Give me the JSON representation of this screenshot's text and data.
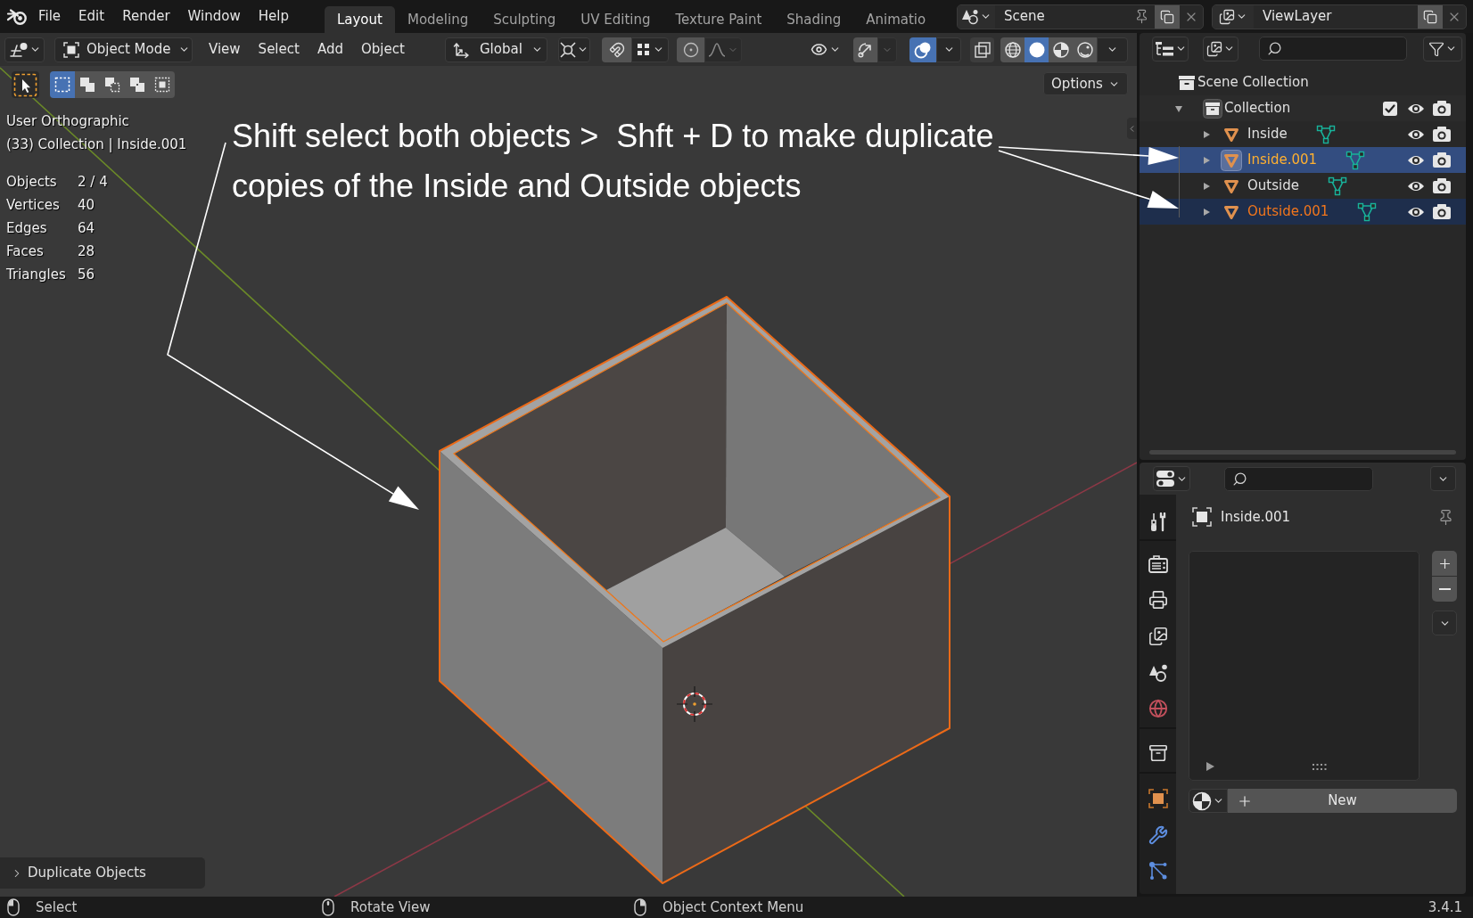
{
  "top_bar": {
    "menus": [
      "File",
      "Edit",
      "Render",
      "Window",
      "Help"
    ],
    "workspaces": [
      {
        "label": "Layout",
        "selected": true
      },
      {
        "label": "Modeling",
        "selected": false
      },
      {
        "label": "Sculpting",
        "selected": false
      },
      {
        "label": "UV Editing",
        "selected": false
      },
      {
        "label": "Texture Paint",
        "selected": false
      },
      {
        "label": "Shading",
        "selected": false
      },
      {
        "label": "Animatio",
        "selected": false
      }
    ],
    "scene": "Scene",
    "view_layer": "ViewLayer"
  },
  "viewport": {
    "header": {
      "mode": "Object Mode",
      "menus": [
        "View",
        "Select",
        "Add",
        "Object"
      ],
      "orientation": "Global",
      "overlays_on": true,
      "shading_modes": [
        {
          "kind": "wireframe",
          "selected": false
        },
        {
          "kind": "solid",
          "selected": true
        },
        {
          "kind": "material",
          "selected": false
        },
        {
          "kind": "rendered",
          "selected": false
        }
      ]
    },
    "selection_modes": [
      {
        "kind": "set",
        "selected": true
      },
      {
        "kind": "extend",
        "selected": false
      },
      {
        "kind": "subtract",
        "selected": false
      },
      {
        "kind": "difference",
        "selected": false
      },
      {
        "kind": "intersect",
        "selected": false
      }
    ],
    "options": "Options",
    "overlay_text": {
      "view": "User Orthographic",
      "context": "(33) Collection | Inside.001",
      "stats": [
        {
          "label": "Objects",
          "value": "2 / 4"
        },
        {
          "label": "Vertices",
          "value": "40"
        },
        {
          "label": "Edges",
          "value": "64"
        },
        {
          "label": "Faces",
          "value": "28"
        },
        {
          "label": "Triangles",
          "value": "56"
        }
      ]
    },
    "annotation": [
      "Shift select both objects >  Shft + D to make duplicate",
      "copies of the Inside and Outside objects"
    ],
    "last_operation": "Duplicate Objects"
  },
  "outliner": {
    "root": "Scene Collection",
    "collections": [
      {
        "label": "Collection",
        "expanded": true,
        "checked": true,
        "children": [
          {
            "label": "Inside",
            "expanded": false,
            "selected": false,
            "active": false
          },
          {
            "label": "Inside.001",
            "expanded": false,
            "selected": true,
            "active": true
          },
          {
            "label": "Outside",
            "expanded": false,
            "selected": false,
            "active": false
          },
          {
            "label": "Outside.001",
            "expanded": false,
            "selected": true,
            "active": false
          }
        ]
      }
    ]
  },
  "properties": {
    "object_name": "Inside.001",
    "new_button": "New"
  },
  "status_bar": {
    "hints": [
      {
        "kind": "left",
        "label": "Select"
      },
      {
        "kind": "middle",
        "label": "Rotate View"
      },
      {
        "kind": "right",
        "label": "Object Context Menu"
      }
    ],
    "version": "3.4.1"
  }
}
